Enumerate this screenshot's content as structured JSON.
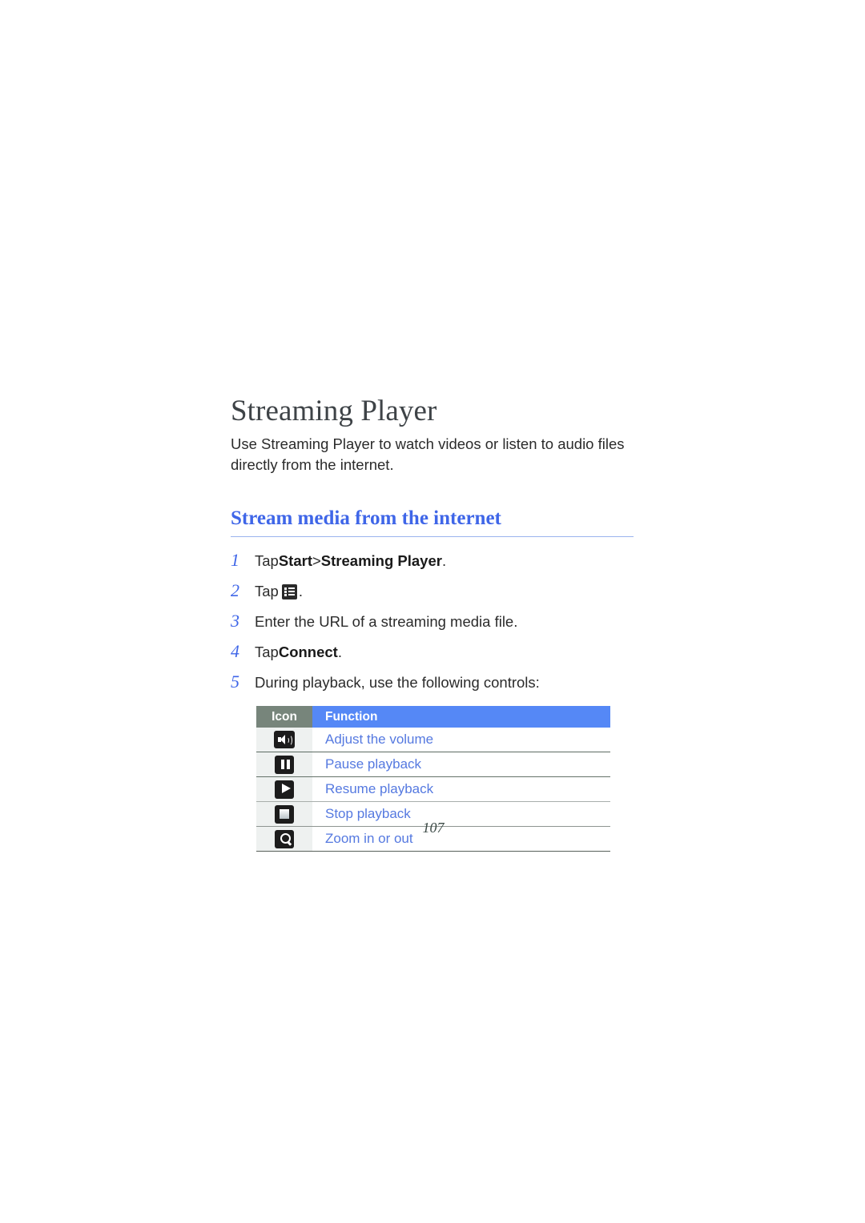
{
  "document": {
    "title": "Streaming Player",
    "intro": "Use Streaming Player to watch videos or listen to audio files directly from the internet.",
    "page_number": "107"
  },
  "section": {
    "heading": "Stream media from the internet"
  },
  "steps": [
    {
      "number": "1",
      "prefix": "Tap ",
      "bold1": "Start",
      "middle": " > ",
      "bold2": "Streaming Player",
      "suffix": ".",
      "has_icon": false
    },
    {
      "number": "2",
      "prefix": "Tap ",
      "bold1": "",
      "middle": "",
      "bold2": "",
      "suffix": ".",
      "has_icon": true,
      "icon_name": "list-menu-icon"
    },
    {
      "number": "3",
      "prefix": "Enter the URL of a streaming media file.",
      "bold1": "",
      "middle": "",
      "bold2": "",
      "suffix": "",
      "has_icon": false
    },
    {
      "number": "4",
      "prefix": "Tap ",
      "bold1": "Connect",
      "middle": "",
      "bold2": "",
      "suffix": ".",
      "has_icon": false
    },
    {
      "number": "5",
      "prefix": "During playback, use the following controls:",
      "bold1": "",
      "middle": "",
      "bold2": "",
      "suffix": "",
      "has_icon": false
    }
  ],
  "controls_table": {
    "headers": {
      "icon": "Icon",
      "function": "Function"
    },
    "rows": [
      {
        "icon": "volume-speaker-icon",
        "function": "Adjust the volume"
      },
      {
        "icon": "pause-icon",
        "function": "Pause playback"
      },
      {
        "icon": "play-icon",
        "function": "Resume playback"
      },
      {
        "icon": "stop-icon",
        "function": "Stop playback"
      },
      {
        "icon": "zoom-magnifier-icon",
        "function": "Zoom in or out"
      }
    ]
  },
  "colors": {
    "heading_blue": "#3f66e8",
    "link_blue": "#5579e0",
    "table_header_blue": "#5588f6",
    "table_header_gray": "#77857b",
    "title_gray": "#3e4347",
    "icon_cell_bg": "#eef1f0"
  }
}
